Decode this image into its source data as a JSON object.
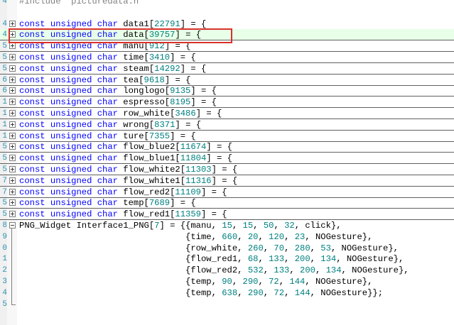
{
  "editor": {
    "lines": [
      {
        "ln": "4",
        "fold": "",
        "parts": [
          {
            "t": "#include ",
            "c": "pre"
          },
          {
            "t": "\"picturedata.h\"",
            "c": "str"
          }
        ]
      },
      {
        "ln": "",
        "fold": "",
        "parts": []
      },
      {
        "ln": "4",
        "fold": "plus",
        "parts": [
          {
            "t": "const unsigned char ",
            "c": "kw"
          },
          {
            "t": "data1[",
            "c": ""
          },
          {
            "t": "22791",
            "c": "num"
          },
          {
            "t": "] = {",
            "c": ""
          }
        ]
      },
      {
        "ln": "4",
        "fold": "plus",
        "current": true,
        "parts": [
          {
            "t": "const unsigned char ",
            "c": "kw"
          },
          {
            "t": "data[",
            "c": ""
          },
          {
            "t": "39757",
            "c": "num"
          },
          {
            "t": "] = {",
            "c": ""
          }
        ]
      },
      {
        "ln": "5",
        "fold": "plus",
        "parts": [
          {
            "t": "const unsigned char ",
            "c": "kw"
          },
          {
            "t": "manu[",
            "c": ""
          },
          {
            "t": "912",
            "c": "num"
          },
          {
            "t": "] = {",
            "c": ""
          }
        ]
      },
      {
        "ln": "5",
        "fold": "plus",
        "parts": [
          {
            "t": "const unsigned char ",
            "c": "kw"
          },
          {
            "t": "time[",
            "c": ""
          },
          {
            "t": "3410",
            "c": "num"
          },
          {
            "t": "] = {",
            "c": ""
          }
        ]
      },
      {
        "ln": "5",
        "fold": "plus",
        "parts": [
          {
            "t": "const unsigned char ",
            "c": "kw"
          },
          {
            "t": "steam[",
            "c": ""
          },
          {
            "t": "14292",
            "c": "num"
          },
          {
            "t": "] = {",
            "c": ""
          }
        ]
      },
      {
        "ln": "6",
        "fold": "plus",
        "parts": [
          {
            "t": "const unsigned char ",
            "c": "kw"
          },
          {
            "t": "tea[",
            "c": ""
          },
          {
            "t": "9618",
            "c": "num"
          },
          {
            "t": "] = {",
            "c": ""
          }
        ]
      },
      {
        "ln": "6",
        "fold": "plus",
        "parts": [
          {
            "t": "const unsigned char ",
            "c": "kw"
          },
          {
            "t": "longlogo[",
            "c": ""
          },
          {
            "t": "9135",
            "c": "num"
          },
          {
            "t": "] = {",
            "c": ""
          }
        ]
      },
      {
        "ln": "1",
        "fold": "plus",
        "parts": [
          {
            "t": "const unsigned char ",
            "c": "kw"
          },
          {
            "t": "espresso[",
            "c": ""
          },
          {
            "t": "8195",
            "c": "num"
          },
          {
            "t": "] = {",
            "c": ""
          }
        ]
      },
      {
        "ln": "1",
        "fold": "plus",
        "parts": [
          {
            "t": "const unsigned char ",
            "c": "kw"
          },
          {
            "t": "row_white[",
            "c": ""
          },
          {
            "t": "3486",
            "c": "num"
          },
          {
            "t": "] = {",
            "c": ""
          }
        ]
      },
      {
        "ln": "1",
        "fold": "plus",
        "parts": [
          {
            "t": "const unsigned char ",
            "c": "kw"
          },
          {
            "t": "wrong[",
            "c": ""
          },
          {
            "t": "8371",
            "c": "num"
          },
          {
            "t": "] = {",
            "c": ""
          }
        ]
      },
      {
        "ln": "1",
        "fold": "plus",
        "parts": [
          {
            "t": "const unsigned char ",
            "c": "kw"
          },
          {
            "t": "ture[",
            "c": ""
          },
          {
            "t": "7355",
            "c": "num"
          },
          {
            "t": "] = {",
            "c": ""
          }
        ]
      },
      {
        "ln": "5",
        "fold": "plus",
        "parts": [
          {
            "t": "const unsigned char ",
            "c": "kw"
          },
          {
            "t": "flow_blue2[",
            "c": ""
          },
          {
            "t": "11674",
            "c": "num"
          },
          {
            "t": "] = {",
            "c": ""
          }
        ]
      },
      {
        "ln": "5",
        "fold": "plus",
        "parts": [
          {
            "t": "const unsigned char ",
            "c": "kw"
          },
          {
            "t": "flow_blue1[",
            "c": ""
          },
          {
            "t": "11804",
            "c": "num"
          },
          {
            "t": "] = {",
            "c": ""
          }
        ]
      },
      {
        "ln": "5",
        "fold": "plus",
        "parts": [
          {
            "t": "const unsigned char ",
            "c": "kw"
          },
          {
            "t": "flow_white2[",
            "c": ""
          },
          {
            "t": "11303",
            "c": "num"
          },
          {
            "t": "] = {",
            "c": ""
          }
        ]
      },
      {
        "ln": "7",
        "fold": "plus",
        "parts": [
          {
            "t": "const unsigned char ",
            "c": "kw"
          },
          {
            "t": "flow_white1[",
            "c": ""
          },
          {
            "t": "11316",
            "c": "num"
          },
          {
            "t": "] = {",
            "c": ""
          }
        ]
      },
      {
        "ln": "7",
        "fold": "plus",
        "parts": [
          {
            "t": "const unsigned char ",
            "c": "kw"
          },
          {
            "t": "flow_red2[",
            "c": ""
          },
          {
            "t": "11109",
            "c": "num"
          },
          {
            "t": "] = {",
            "c": ""
          }
        ]
      },
      {
        "ln": "5",
        "fold": "plus",
        "parts": [
          {
            "t": "const unsigned char ",
            "c": "kw"
          },
          {
            "t": "temp[",
            "c": ""
          },
          {
            "t": "7689",
            "c": "num"
          },
          {
            "t": "] = {",
            "c": ""
          }
        ]
      },
      {
        "ln": "5",
        "fold": "plus",
        "parts": [
          {
            "t": "const unsigned char ",
            "c": "kw"
          },
          {
            "t": "flow_red1[",
            "c": ""
          },
          {
            "t": "11359",
            "c": "num"
          },
          {
            "t": "] = {",
            "c": ""
          }
        ]
      },
      {
        "ln": "8",
        "fold": "minus",
        "parts": [
          {
            "t": "PNG_Widget Interface1_PNG[",
            "c": ""
          },
          {
            "t": "7",
            "c": "num"
          },
          {
            "t": "] = {{manu, ",
            "c": ""
          },
          {
            "t": "15",
            "c": "num"
          },
          {
            "t": ", ",
            "c": ""
          },
          {
            "t": "15",
            "c": "num"
          },
          {
            "t": ", ",
            "c": ""
          },
          {
            "t": "50",
            "c": "num"
          },
          {
            "t": ", ",
            "c": ""
          },
          {
            "t": "32",
            "c": "num"
          },
          {
            "t": ", click},",
            "c": ""
          }
        ]
      },
      {
        "ln": "9",
        "fold": "",
        "parts": [
          {
            "t": "                                {time, ",
            "c": ""
          },
          {
            "t": "660",
            "c": "num"
          },
          {
            "t": ", ",
            "c": ""
          },
          {
            "t": "20",
            "c": "num"
          },
          {
            "t": ", ",
            "c": ""
          },
          {
            "t": "120",
            "c": "num"
          },
          {
            "t": ", ",
            "c": ""
          },
          {
            "t": "23",
            "c": "num"
          },
          {
            "t": ", NOGesture},",
            "c": ""
          }
        ]
      },
      {
        "ln": "0",
        "fold": "",
        "parts": [
          {
            "t": "                                {row_white, ",
            "c": ""
          },
          {
            "t": "260",
            "c": "num"
          },
          {
            "t": ", ",
            "c": ""
          },
          {
            "t": "70",
            "c": "num"
          },
          {
            "t": ", ",
            "c": ""
          },
          {
            "t": "280",
            "c": "num"
          },
          {
            "t": ", ",
            "c": ""
          },
          {
            "t": "53",
            "c": "num"
          },
          {
            "t": ", NOGesture},",
            "c": ""
          }
        ]
      },
      {
        "ln": "1",
        "fold": "",
        "parts": [
          {
            "t": "                                {flow_red1, ",
            "c": ""
          },
          {
            "t": "68",
            "c": "num"
          },
          {
            "t": ", ",
            "c": ""
          },
          {
            "t": "133",
            "c": "num"
          },
          {
            "t": ", ",
            "c": ""
          },
          {
            "t": "200",
            "c": "num"
          },
          {
            "t": ", ",
            "c": ""
          },
          {
            "t": "134",
            "c": "num"
          },
          {
            "t": ", NOGesture},",
            "c": ""
          }
        ]
      },
      {
        "ln": "2",
        "fold": "",
        "parts": [
          {
            "t": "                                {flow_red2, ",
            "c": ""
          },
          {
            "t": "532",
            "c": "num"
          },
          {
            "t": ", ",
            "c": ""
          },
          {
            "t": "133",
            "c": "num"
          },
          {
            "t": ", ",
            "c": ""
          },
          {
            "t": "200",
            "c": "num"
          },
          {
            "t": ", ",
            "c": ""
          },
          {
            "t": "134",
            "c": "num"
          },
          {
            "t": ", NOGesture},",
            "c": ""
          }
        ]
      },
      {
        "ln": "3",
        "fold": "",
        "parts": [
          {
            "t": "                                {temp, ",
            "c": ""
          },
          {
            "t": "90",
            "c": "num"
          },
          {
            "t": ", ",
            "c": ""
          },
          {
            "t": "290",
            "c": "num"
          },
          {
            "t": ", ",
            "c": ""
          },
          {
            "t": "72",
            "c": "num"
          },
          {
            "t": ", ",
            "c": ""
          },
          {
            "t": "144",
            "c": "num"
          },
          {
            "t": ", NOGesture},",
            "c": ""
          }
        ]
      },
      {
        "ln": "4",
        "fold": "",
        "parts": [
          {
            "t": "                                {temp, ",
            "c": ""
          },
          {
            "t": "638",
            "c": "num"
          },
          {
            "t": ", ",
            "c": ""
          },
          {
            "t": "290",
            "c": "num"
          },
          {
            "t": ", ",
            "c": ""
          },
          {
            "t": "72",
            "c": "num"
          },
          {
            "t": ", ",
            "c": ""
          },
          {
            "t": "144",
            "c": "num"
          },
          {
            "t": ", NOGesture}};",
            "c": ""
          }
        ]
      },
      {
        "ln": "5",
        "fold": "",
        "parts": []
      },
      {
        "ln": "",
        "fold": "",
        "parts": []
      }
    ]
  },
  "colors": {
    "keyword": "#0000ff",
    "number": "#008080",
    "current_line": "#e8ffe8",
    "annotation_box": "#d9322a"
  }
}
